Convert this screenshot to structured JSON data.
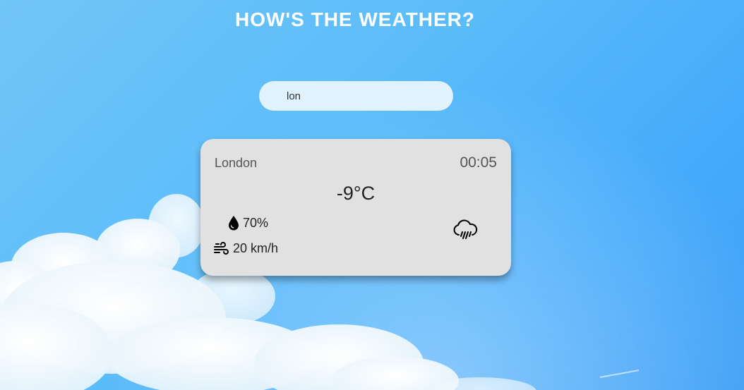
{
  "header": {
    "title": "HOW'S THE WEATHER?"
  },
  "search": {
    "value": "lon"
  },
  "weather": {
    "city": "London",
    "time": "00:05",
    "temperature": "-9°C",
    "humidity": "70%",
    "wind": "20 km/h",
    "condition_icon": "rain-cloud-icon"
  },
  "colors": {
    "card_bg": "#e1e1e1",
    "search_bg": "#dff2fd",
    "title": "#ffffff"
  }
}
